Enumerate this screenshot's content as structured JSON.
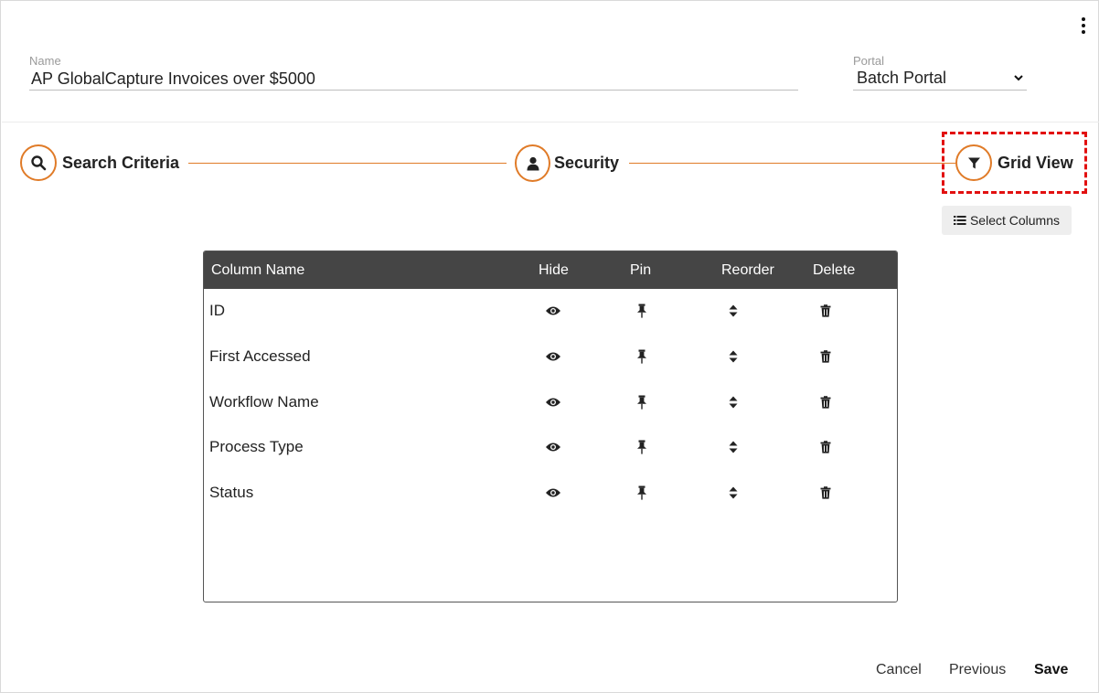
{
  "header": {
    "name_label": "Name",
    "name_value": "AP GlobalCapture Invoices over $5000",
    "portal_label": "Portal",
    "portal_value": "Batch Portal",
    "menu_icon": "more-vertical-icon"
  },
  "steps": [
    {
      "label": "Search Criteria",
      "icon": "search-icon"
    },
    {
      "label": "Security",
      "icon": "user-icon"
    },
    {
      "label": "Grid View",
      "icon": "filter-icon"
    }
  ],
  "toolbar": {
    "select_columns_label": "Select Columns",
    "select_columns_icon": "list-icon"
  },
  "grid": {
    "headers": {
      "column_name": "Column Name",
      "hide": "Hide",
      "pin": "Pin",
      "reorder": "Reorder",
      "delete": "Delete"
    },
    "rows": [
      {
        "name": "ID"
      },
      {
        "name": "First Accessed"
      },
      {
        "name": "Workflow Name"
      },
      {
        "name": "Process Type"
      },
      {
        "name": "Status"
      }
    ]
  },
  "footer": {
    "cancel_label": "Cancel",
    "previous_label": "Previous",
    "save_label": "Save"
  },
  "colors": {
    "accent": "#e07b28",
    "highlight": "#e21010",
    "grid_header_bg": "#454545"
  }
}
